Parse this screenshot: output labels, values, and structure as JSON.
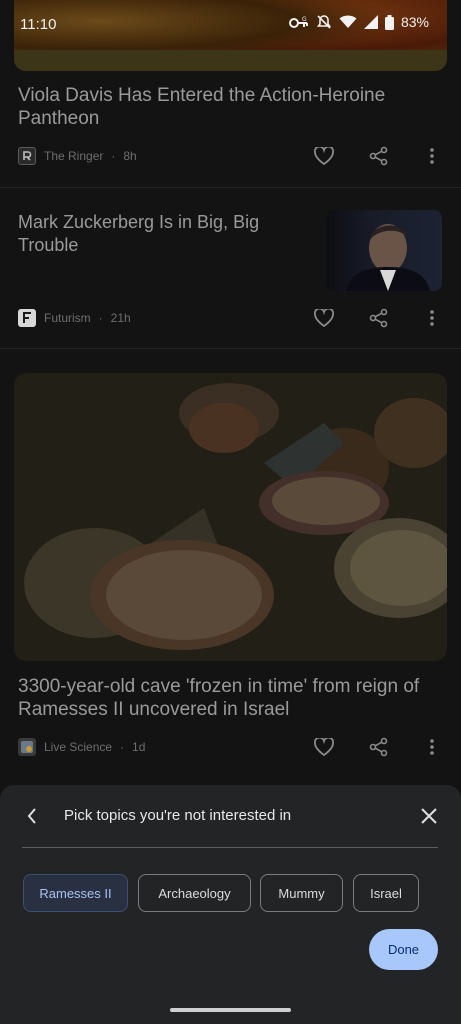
{
  "status_bar": {
    "time": "11:10",
    "battery": "83%",
    "icons": [
      "vpn-key-icon",
      "mute-icon",
      "wifi-icon",
      "signal-icon",
      "battery-icon"
    ]
  },
  "articles": [
    {
      "title": "Viola Davis Has Entered the Action-Heroine Pantheon",
      "source": "The Ringer",
      "age": "8h"
    },
    {
      "title": "Mark Zuckerberg Is in Big, Big Trouble",
      "source": "Futurism",
      "age": "21h"
    },
    {
      "title": "3300-year-old cave 'frozen in time' from reign of Ramesses II uncovered in Israel",
      "source": "Live Science",
      "age": "1d"
    }
  ],
  "sheet": {
    "title": "Pick topics you're not interested in",
    "topics": [
      "Ramesses II",
      "Archaeology",
      "Mummy",
      "Israel"
    ],
    "selected_topic": "Ramesses II",
    "done_label": "Done"
  },
  "colors": {
    "sheet_bg": "#232426",
    "done_bg": "#a8c7fa",
    "chip_selected_text": "#a9c2f2"
  }
}
